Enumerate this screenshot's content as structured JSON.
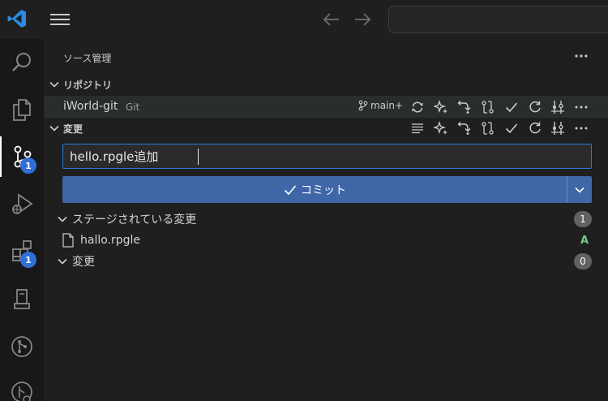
{
  "panel": {
    "title": "ソース管理",
    "repositories_label": "リポジトリ",
    "changes_label": "変更"
  },
  "repo": {
    "name": "iWorld-git",
    "type": "Git",
    "branch": "main+"
  },
  "commit": {
    "message": "hello.rpgle追加",
    "button_label": "コミット"
  },
  "staged": {
    "label": "ステージされている変更",
    "count": "1",
    "files": [
      {
        "name": "hallo.rpgle",
        "status": "A"
      }
    ]
  },
  "changes": {
    "label": "変更",
    "count": "0"
  },
  "activity": {
    "scm_badge": "1",
    "extensions_badge": "1"
  },
  "colors": {
    "accent": "#3f67a8",
    "badge": "#2f6fd6",
    "added": "#73c991"
  }
}
